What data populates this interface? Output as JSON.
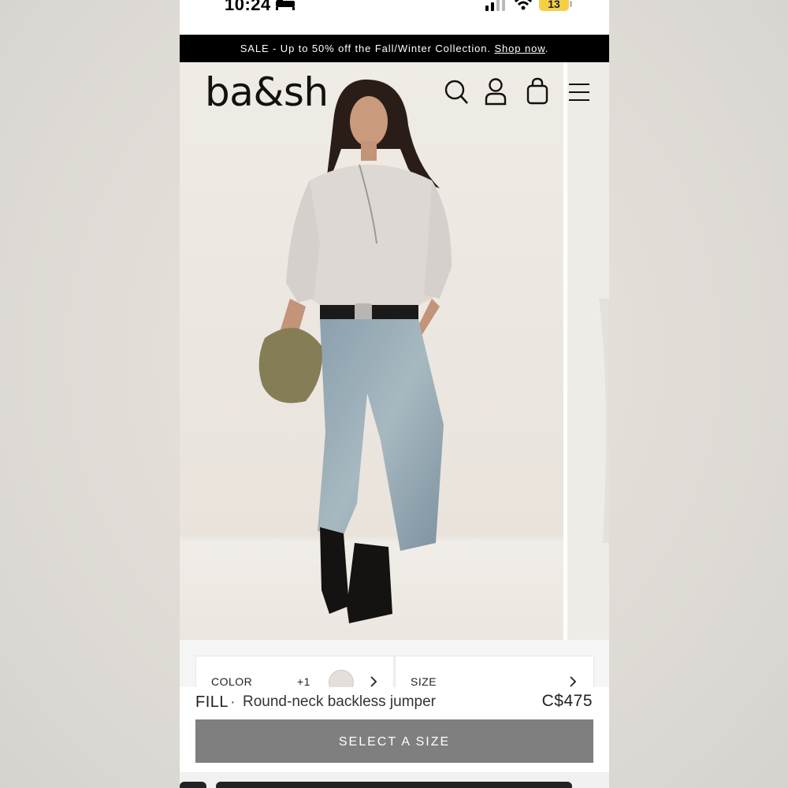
{
  "status_bar": {
    "time": "10:24",
    "battery": "13"
  },
  "promo": {
    "text": "SALE - Up to 50% off the Fall/Winter Collection. ",
    "link": "Shop now",
    "suffix": "."
  },
  "header": {
    "logo": "ba&sh"
  },
  "selectors": {
    "color_label": "COLOR",
    "color_more": "+1",
    "size_label": "SIZE"
  },
  "product": {
    "name": "FILL",
    "separator": "·",
    "description": "Round-neck backless jumper",
    "price": "C$475"
  },
  "cta": {
    "label": "SELECT A SIZE"
  }
}
